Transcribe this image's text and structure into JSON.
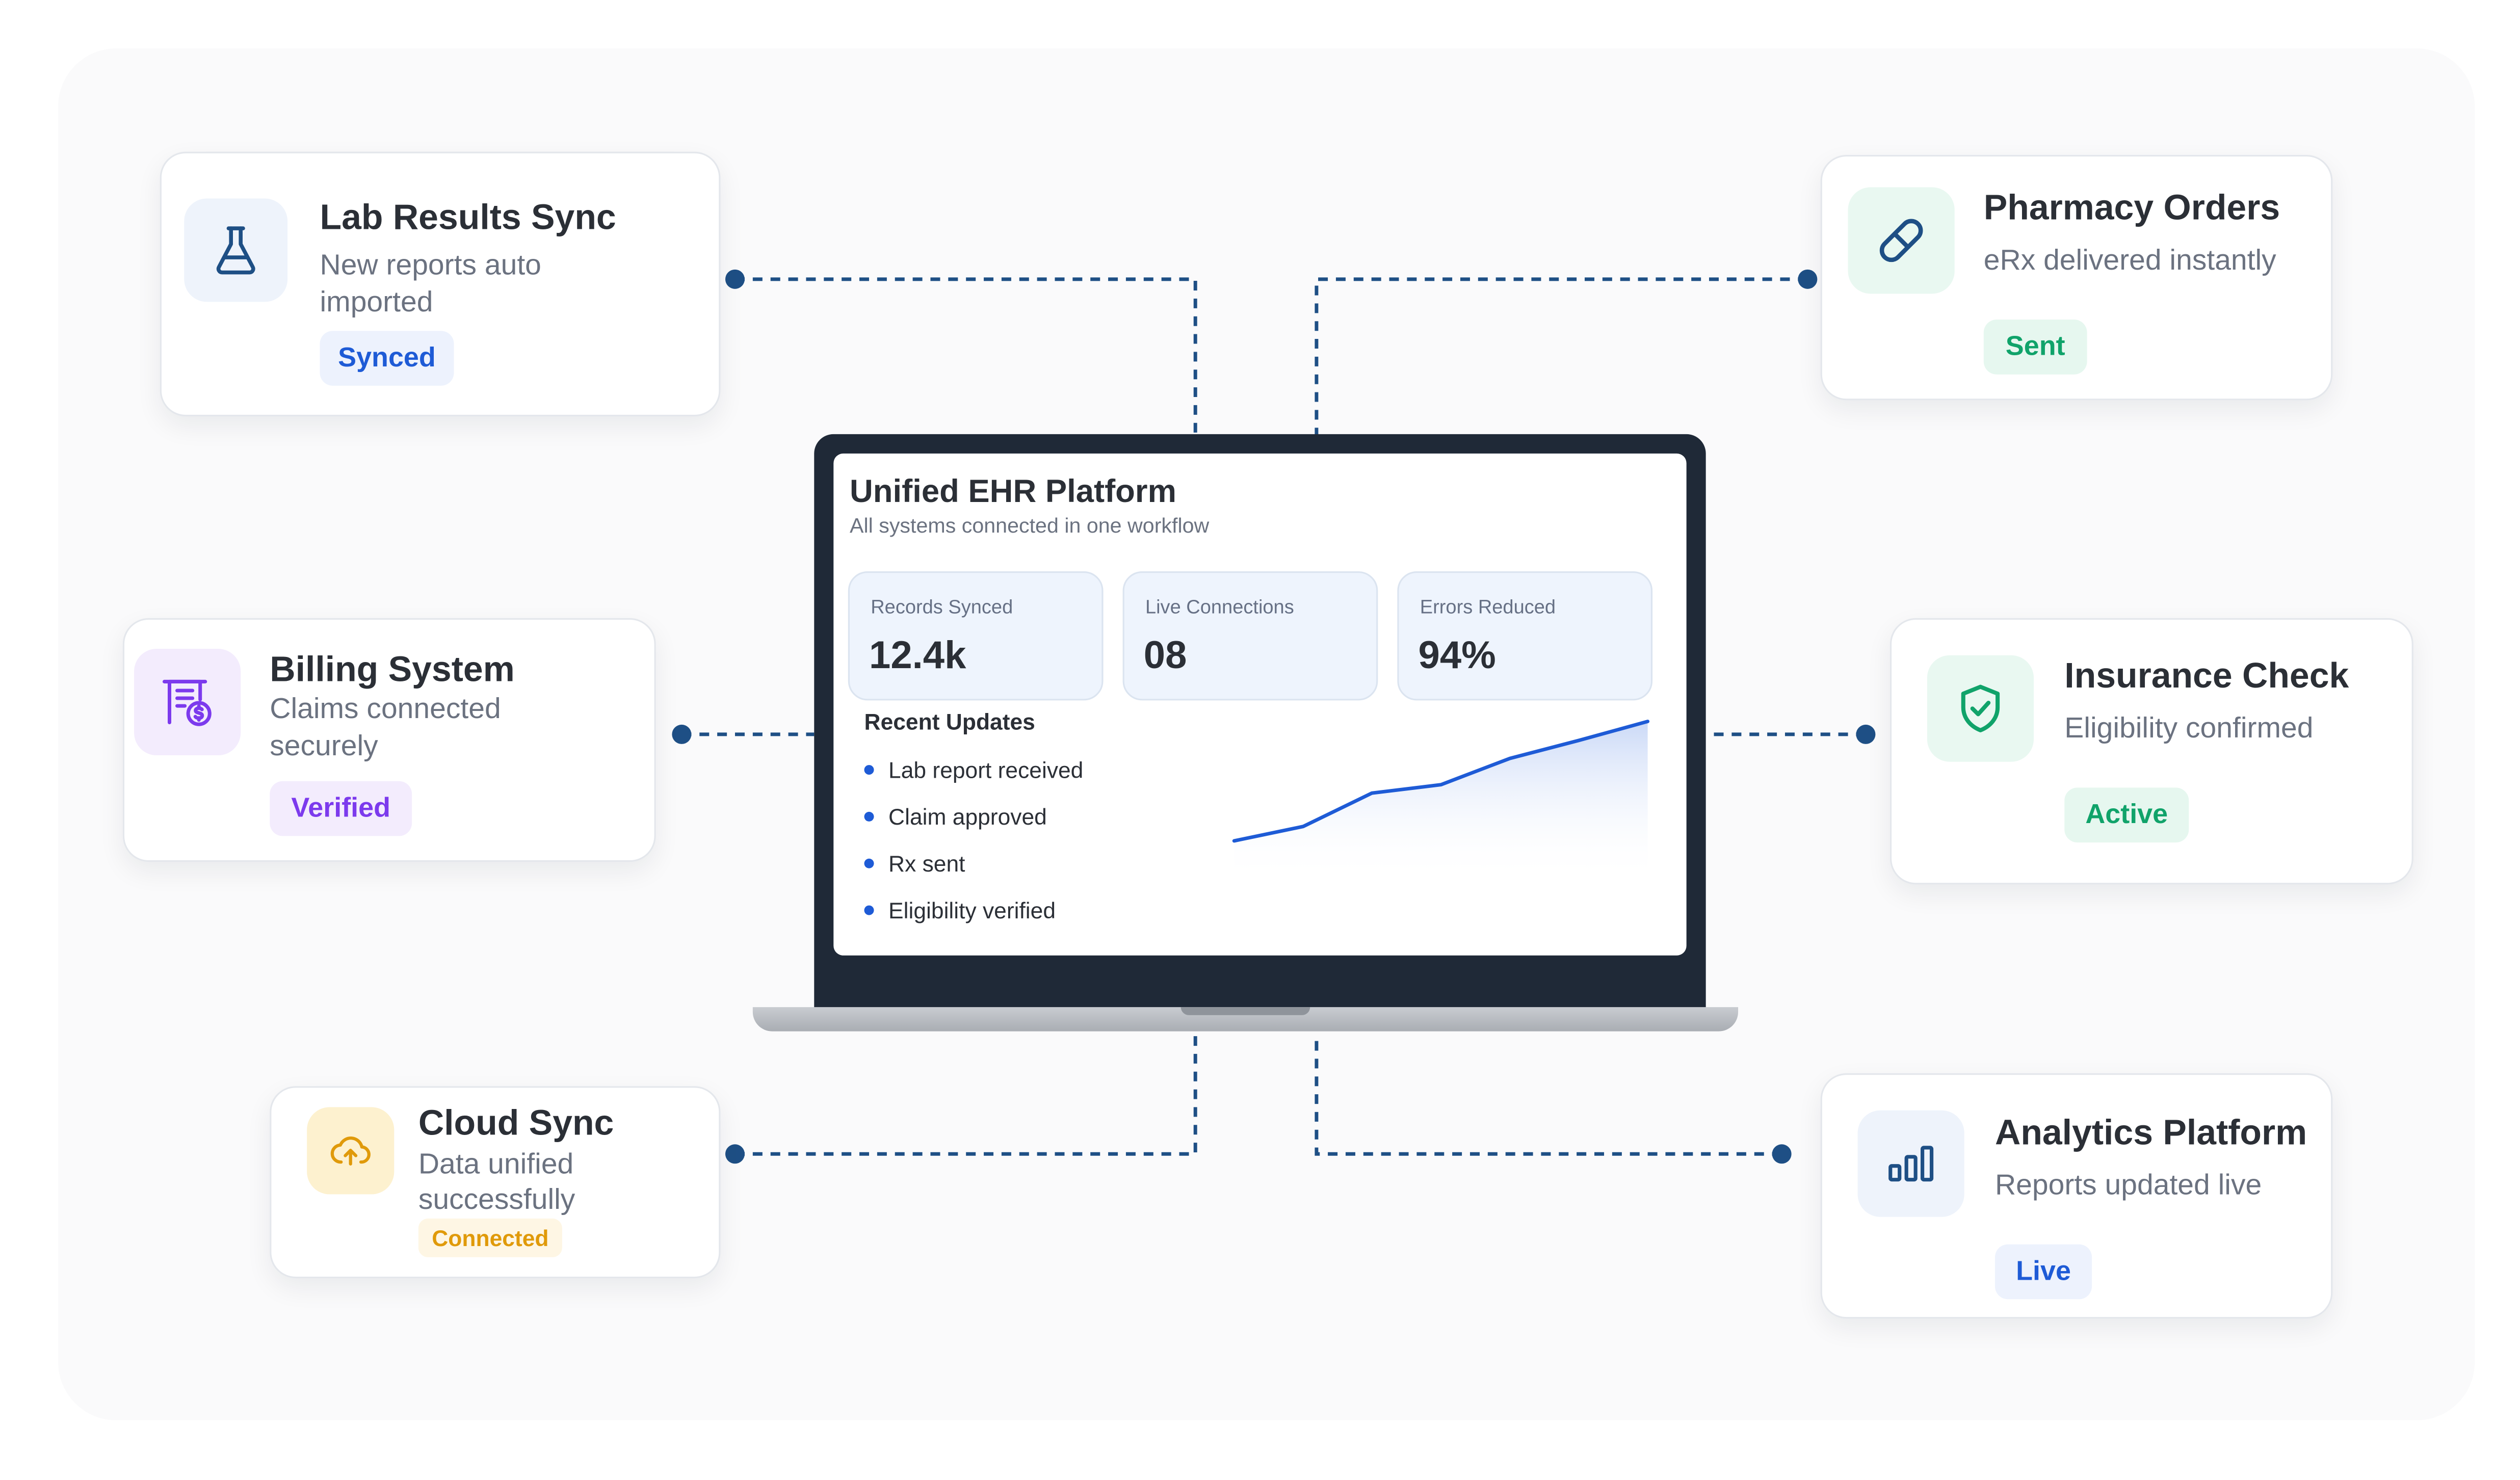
{
  "platform": {
    "title": "Unified EHR Platform",
    "subtitle": "All systems connected in one workflow",
    "stats": [
      {
        "label": "Records Synced",
        "value": "12.4k"
      },
      {
        "label": "Live Connections",
        "value": "08"
      },
      {
        "label": "Errors Reduced",
        "value": "94%"
      }
    ],
    "updates_title": "Recent Updates",
    "updates": [
      "Lab report received",
      "Claim approved",
      "Rx sent",
      "Eligibility verified"
    ],
    "trend_values": [
      0.0,
      0.12,
      0.4,
      0.47,
      0.69,
      0.84,
      1.0
    ]
  },
  "integrations": {
    "lab": {
      "title": "Lab Results Sync",
      "desc": "New reports auto imported",
      "badge": "Synced",
      "icon": "flask-icon"
    },
    "pharmacy": {
      "title": "Pharmacy Orders",
      "desc": "eRx delivered instantly",
      "badge": "Sent",
      "icon": "pill-icon"
    },
    "billing": {
      "title": "Billing System",
      "desc": "Claims connected securely",
      "badge": "Verified",
      "icon": "invoice-dollar-icon"
    },
    "insurance": {
      "title": "Insurance Check",
      "desc": "Eligibility confirmed",
      "badge": "Active",
      "icon": "shield-check-icon"
    },
    "cloud": {
      "title": "Cloud Sync",
      "desc": "Data unified successfully",
      "badge": "Connected",
      "icon": "cloud-upload-icon"
    },
    "analytics": {
      "title": "Analytics Platform",
      "desc": "Reports updated live",
      "badge": "Live",
      "icon": "bar-chart-icon"
    }
  },
  "colors": {
    "connector": "#1e4f85",
    "trend_line": "#1e5bd6",
    "blue_badge_bg": "#edf2fd",
    "blue_badge_text": "#1e5bd6",
    "green_badge_bg": "#e6f7ef",
    "green_badge_text": "#10a36a",
    "purple_badge_bg": "#f3ecfd",
    "purple_badge_text": "#7c3aed",
    "amber_badge_bg": "#fef6e4",
    "amber_badge_text": "#e09a0a"
  }
}
